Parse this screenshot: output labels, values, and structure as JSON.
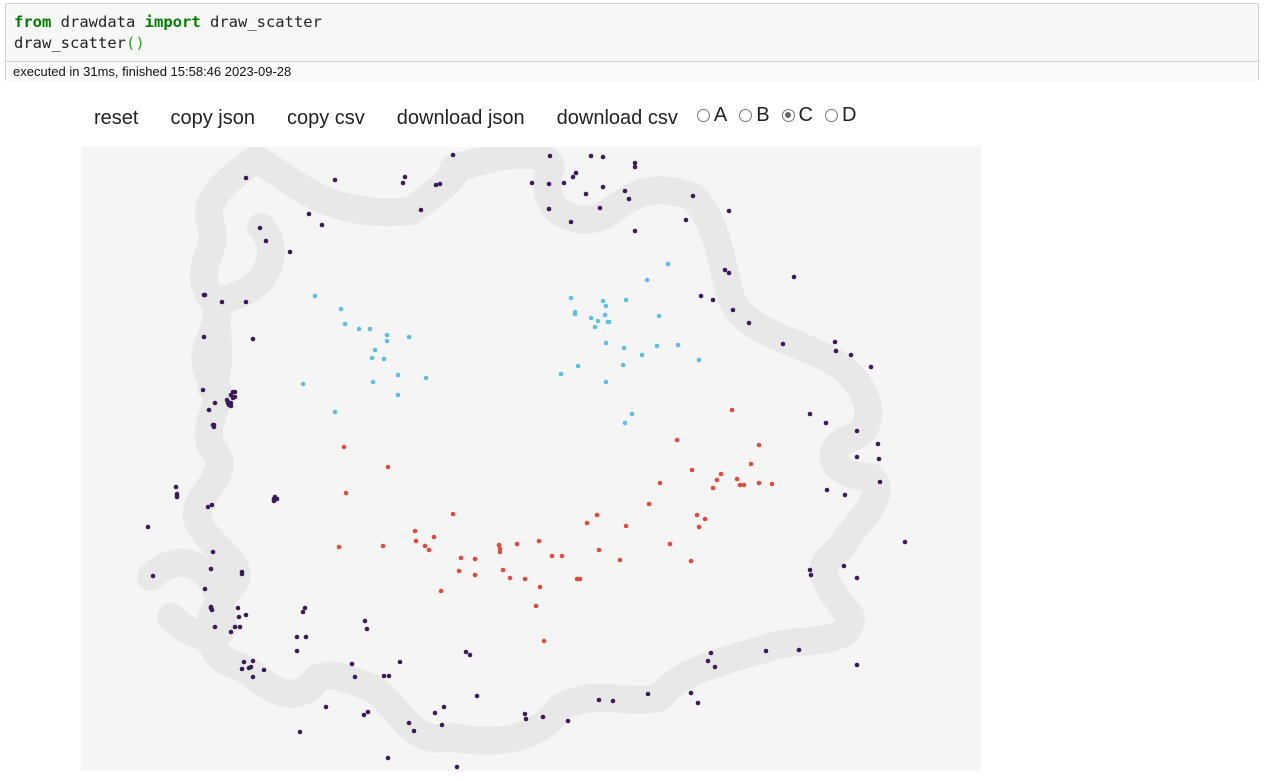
{
  "code": {
    "line1": {
      "kw1": "from",
      "mod": " drawdata ",
      "kw2": "import",
      "name": " draw_scatter"
    },
    "line2": {
      "fn": "draw_scatter",
      "parens": "()"
    }
  },
  "status_text": "executed in 31ms, finished 15:58:46 2023-09-28",
  "toolbar": {
    "reset": "reset",
    "copy_json": "copy json",
    "copy_csv": "copy csv",
    "download_json": "download json",
    "download_csv": "download csv"
  },
  "radios": {
    "options": [
      "A",
      "B",
      "C",
      "D"
    ],
    "selected": "C"
  },
  "colors": {
    "A": "#3b1a5a",
    "B": "#5dbfe8",
    "C": "#e24a3b",
    "brush": "#e8e8e8"
  },
  "chart_data": {
    "type": "scatter",
    "xlim": [
      0,
      900
    ],
    "ylim": [
      0,
      624
    ],
    "series": [
      {
        "name": "A",
        "color": "#3b1a5a",
        "points": [
          [
            372,
            8
          ],
          [
            324,
            30
          ],
          [
            254,
            33
          ],
          [
            355,
            38
          ],
          [
            165,
            31
          ],
          [
            322,
            36
          ],
          [
            359,
            37
          ],
          [
            469,
            9
          ],
          [
            510,
            9
          ],
          [
            522,
            10
          ],
          [
            554,
            16
          ],
          [
            554,
            20
          ],
          [
            451,
            36
          ],
          [
            468,
            37
          ],
          [
            492,
            30
          ],
          [
            483,
            36
          ],
          [
            495,
            26
          ],
          [
            505,
            47
          ],
          [
            522,
            40
          ],
          [
            544,
            44
          ],
          [
            548,
            52
          ],
          [
            468,
            62
          ],
          [
            490,
            75
          ],
          [
            519,
            61
          ],
          [
            554,
            84
          ],
          [
            612,
            49
          ],
          [
            605,
            73
          ],
          [
            648,
            64
          ],
          [
            644,
            123
          ],
          [
            648,
            126
          ],
          [
            620,
            149
          ],
          [
            632,
            153
          ],
          [
            652,
            163
          ],
          [
            668,
            176
          ],
          [
            713,
            130
          ],
          [
            754,
            195
          ],
          [
            702,
            197
          ],
          [
            755,
            204
          ],
          [
            770,
            208
          ],
          [
            790,
            220
          ],
          [
            729,
            267
          ],
          [
            745,
            276
          ],
          [
            776,
            284
          ],
          [
            797,
            297
          ],
          [
            746,
            343
          ],
          [
            764,
            348
          ],
          [
            799,
            335
          ],
          [
            824,
            395
          ],
          [
            798,
            312
          ],
          [
            776,
            310
          ],
          [
            763,
            419
          ],
          [
            729,
            423
          ],
          [
            730,
            428
          ],
          [
            776,
            431
          ],
          [
            776,
            518
          ],
          [
            718,
            503
          ],
          [
            685,
            504
          ],
          [
            630,
            506
          ],
          [
            627,
            514
          ],
          [
            634,
            520
          ],
          [
            610,
            546
          ],
          [
            617,
            556
          ],
          [
            567,
            547
          ],
          [
            532,
            554
          ],
          [
            518,
            553
          ],
          [
            487,
            574
          ],
          [
            462,
            570
          ],
          [
            445,
            572
          ],
          [
            396,
            549
          ],
          [
            354,
            566
          ],
          [
            361,
            578
          ],
          [
            328,
            576
          ],
          [
            444,
            567
          ],
          [
            363,
            560
          ],
          [
            307,
            611
          ],
          [
            333,
            584
          ],
          [
            287,
            565
          ],
          [
            283,
            568
          ],
          [
            274,
            530
          ],
          [
            319,
            515
          ],
          [
            303,
            529
          ],
          [
            385,
            505
          ],
          [
            308,
            529
          ],
          [
            389,
            508
          ],
          [
            216,
            490
          ],
          [
            216,
            504
          ],
          [
            271,
            517
          ],
          [
            225,
            490
          ],
          [
            170,
            520
          ],
          [
            183,
            523
          ],
          [
            163,
            515
          ],
          [
            161,
            425
          ],
          [
            168,
            521
          ],
          [
            219,
            585
          ],
          [
            172,
            530
          ],
          [
            159,
            480
          ],
          [
            165,
            468
          ],
          [
            157,
            461
          ],
          [
            154,
            480
          ],
          [
            150,
            485
          ],
          [
            161,
            522
          ],
          [
            131,
            463
          ],
          [
            124,
            442
          ],
          [
            130,
            422
          ],
          [
            172,
            514
          ],
          [
            72,
            429
          ],
          [
            67,
            380
          ],
          [
            96,
            349
          ],
          [
            130,
            461
          ],
          [
            284,
            474
          ],
          [
            286,
            482
          ],
          [
            222,
            465
          ],
          [
            224,
            461
          ],
          [
            193,
            354
          ],
          [
            127,
            360
          ],
          [
            131,
            358
          ],
          [
            132,
            405
          ],
          [
            96,
            350
          ],
          [
            134,
            480
          ],
          [
            158,
            470
          ],
          [
            245,
            560
          ],
          [
            376,
            620
          ],
          [
            196,
            352
          ],
          [
            194,
            350
          ],
          [
            193,
            352
          ],
          [
            133,
            278
          ],
          [
            122,
            243
          ],
          [
            123,
            190
          ],
          [
            141,
            155
          ],
          [
            172,
            192
          ],
          [
            165,
            155
          ],
          [
            124,
            148
          ],
          [
            134,
            256
          ],
          [
            150,
            256
          ],
          [
            154,
            245
          ],
          [
            146,
            253
          ],
          [
            150,
            248
          ],
          [
            154,
            250
          ],
          [
            147,
            255
          ],
          [
            152,
            251
          ],
          [
            96,
            347
          ],
          [
            95,
            340
          ],
          [
            130,
            460
          ],
          [
            161,
            427
          ],
          [
            179,
            81
          ],
          [
            185,
            94
          ],
          [
            209,
            105
          ],
          [
            228,
            67
          ],
          [
            241,
            78
          ],
          [
            340,
            63
          ],
          [
            149,
            257
          ],
          [
            147,
            256
          ],
          [
            148,
            258
          ],
          [
            128,
            263
          ],
          [
            150,
            259
          ],
          [
            132,
            278
          ],
          [
            133,
            280
          ],
          [
            123,
            148
          ],
          [
            152,
            245
          ]
        ]
      },
      {
        "name": "B",
        "color": "#5dbfe8",
        "points": [
          [
            234,
            149
          ],
          [
            260,
            162
          ],
          [
            264,
            177
          ],
          [
            289,
            182
          ],
          [
            306,
            188
          ],
          [
            328,
            190
          ],
          [
            278,
            182
          ],
          [
            306,
            194
          ],
          [
            291,
            211
          ],
          [
            303,
            212
          ],
          [
            294,
            203
          ],
          [
            317,
            228
          ],
          [
            292,
            235
          ],
          [
            222,
            237
          ],
          [
            254,
            265
          ],
          [
            345,
            231
          ],
          [
            317,
            248
          ],
          [
            587,
            117
          ],
          [
            566,
            133
          ],
          [
            490,
            151
          ],
          [
            522,
            154
          ],
          [
            525,
            159
          ],
          [
            545,
            153
          ],
          [
            494,
            165
          ],
          [
            517,
            174
          ],
          [
            527,
            175
          ],
          [
            524,
            168
          ],
          [
            514,
            180
          ],
          [
            528,
            175
          ],
          [
            578,
            169
          ],
          [
            525,
            196
          ],
          [
            543,
            201
          ],
          [
            576,
            199
          ],
          [
            597,
            198
          ],
          [
            561,
            208
          ],
          [
            618,
            213
          ],
          [
            542,
            218
          ],
          [
            497,
            219
          ],
          [
            480,
            227
          ],
          [
            525,
            235
          ],
          [
            551,
            267
          ],
          [
            544,
            276
          ],
          [
            494,
            167
          ],
          [
            510,
            171
          ]
        ]
      },
      {
        "name": "C",
        "color": "#e24a3b",
        "points": [
          [
            651,
            263
          ],
          [
            596,
            293
          ],
          [
            678,
            298
          ],
          [
            611,
            323
          ],
          [
            670,
            317
          ],
          [
            640,
            327
          ],
          [
            656,
            332
          ],
          [
            678,
            336
          ],
          [
            659,
            338
          ],
          [
            663,
            338
          ],
          [
            691,
            337
          ],
          [
            632,
            341
          ],
          [
            636,
            333
          ],
          [
            579,
            336
          ],
          [
            568,
            357
          ],
          [
            372,
            367
          ],
          [
            516,
            368
          ],
          [
            506,
            376
          ],
          [
            545,
            379
          ],
          [
            616,
            368
          ],
          [
            624,
            372
          ],
          [
            618,
            380
          ],
          [
            589,
            397
          ],
          [
            610,
            414
          ],
          [
            334,
            384
          ],
          [
            335,
            394
          ],
          [
            353,
            390
          ],
          [
            344,
            399
          ],
          [
            348,
            403
          ],
          [
            302,
            399
          ],
          [
            263,
            300
          ],
          [
            307,
            320
          ],
          [
            265,
            346
          ],
          [
            258,
            400
          ],
          [
            418,
            398
          ],
          [
            419,
            402
          ],
          [
            419,
            405
          ],
          [
            436,
            397
          ],
          [
            458,
            394
          ],
          [
            471,
            409
          ],
          [
            380,
            411
          ],
          [
            394,
            412
          ],
          [
            378,
            424
          ],
          [
            394,
            428
          ],
          [
            422,
            423
          ],
          [
            429,
            431
          ],
          [
            444,
            432
          ],
          [
            481,
            409
          ],
          [
            499,
            432
          ],
          [
            459,
            440
          ],
          [
            455,
            459
          ],
          [
            539,
            413
          ],
          [
            518,
            403
          ],
          [
            360,
            444
          ],
          [
            463,
            494
          ],
          [
            496,
            432
          ]
        ]
      },
      {
        "name": "D",
        "color": "#3b1a5a",
        "points": []
      }
    ]
  }
}
